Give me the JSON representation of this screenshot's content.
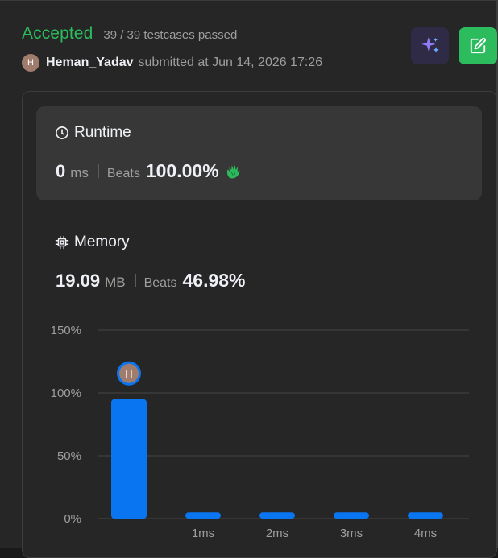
{
  "header": {
    "status": "Accepted",
    "testcases": "39 / 39 testcases passed",
    "avatar_letter": "H",
    "username": "Heman_Yadav",
    "submitted_text": "submitted at Jun 14, 2026 17:26"
  },
  "buttons": {
    "ai_icon": "sparkles-icon",
    "edit_icon": "edit-note-icon"
  },
  "runtime": {
    "title": "Runtime",
    "value": "0",
    "unit": "ms",
    "beats_label": "Beats",
    "beats_value": "100.00%"
  },
  "memory": {
    "title": "Memory",
    "value": "19.09",
    "unit": "MB",
    "beats_label": "Beats",
    "beats_value": "46.98%"
  },
  "colors": {
    "accepted": "#2cbb5d",
    "bar": "#0a75f0",
    "edit_button": "#2cbb5d",
    "ai_button": "#2f2a45"
  },
  "chart_data": {
    "type": "bar",
    "categories": [
      "",
      "1ms",
      "2ms",
      "3ms",
      "4ms"
    ],
    "values": [
      95,
      5,
      5,
      5,
      5
    ],
    "ylim": [
      0,
      150
    ],
    "yticks": [
      "0%",
      "50%",
      "100%",
      "150%"
    ],
    "ytick_values": [
      0,
      50,
      100,
      150
    ],
    "marker_category_index": 0,
    "marker_letter": "H",
    "grid": true
  }
}
